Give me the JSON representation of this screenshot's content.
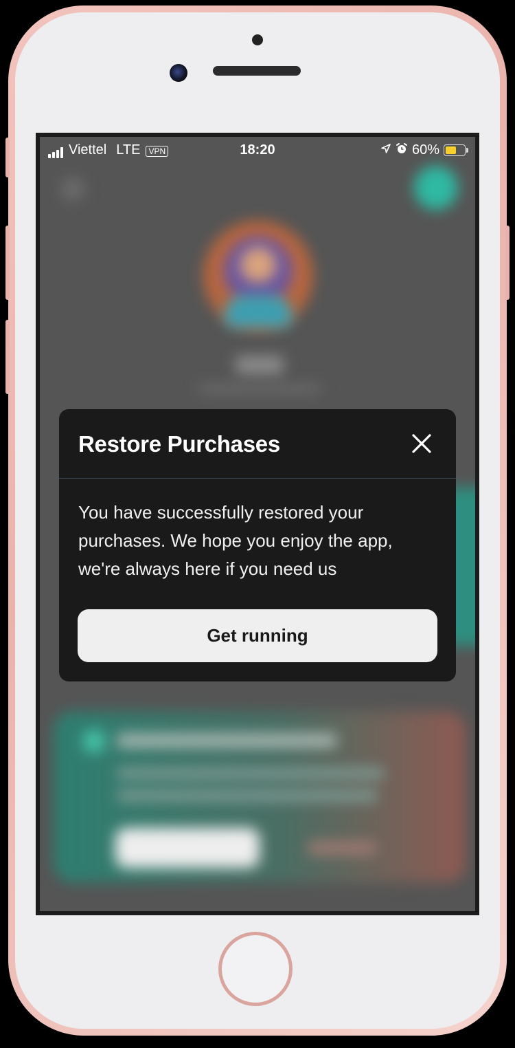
{
  "status_bar": {
    "carrier": "Viettel",
    "network": "LTE",
    "vpn": "VPN",
    "time": "18:20",
    "battery_percent": "60%",
    "battery_level": 0.6,
    "icons": [
      "signal-icon",
      "location-arrow-icon",
      "alarm-icon",
      "battery-icon"
    ]
  },
  "modal": {
    "title": "Restore Purchases",
    "message": "You have successfully restored your purchases. We hope you enjoy the app, we're always here if you need us",
    "button_label": "Get running",
    "close_icon": "close-icon"
  },
  "colors": {
    "modal_background": "#1a1a1a",
    "button_background": "#efefef",
    "accent_teal": "#2fb9a3",
    "battery_fill": "#f5cf2a"
  }
}
